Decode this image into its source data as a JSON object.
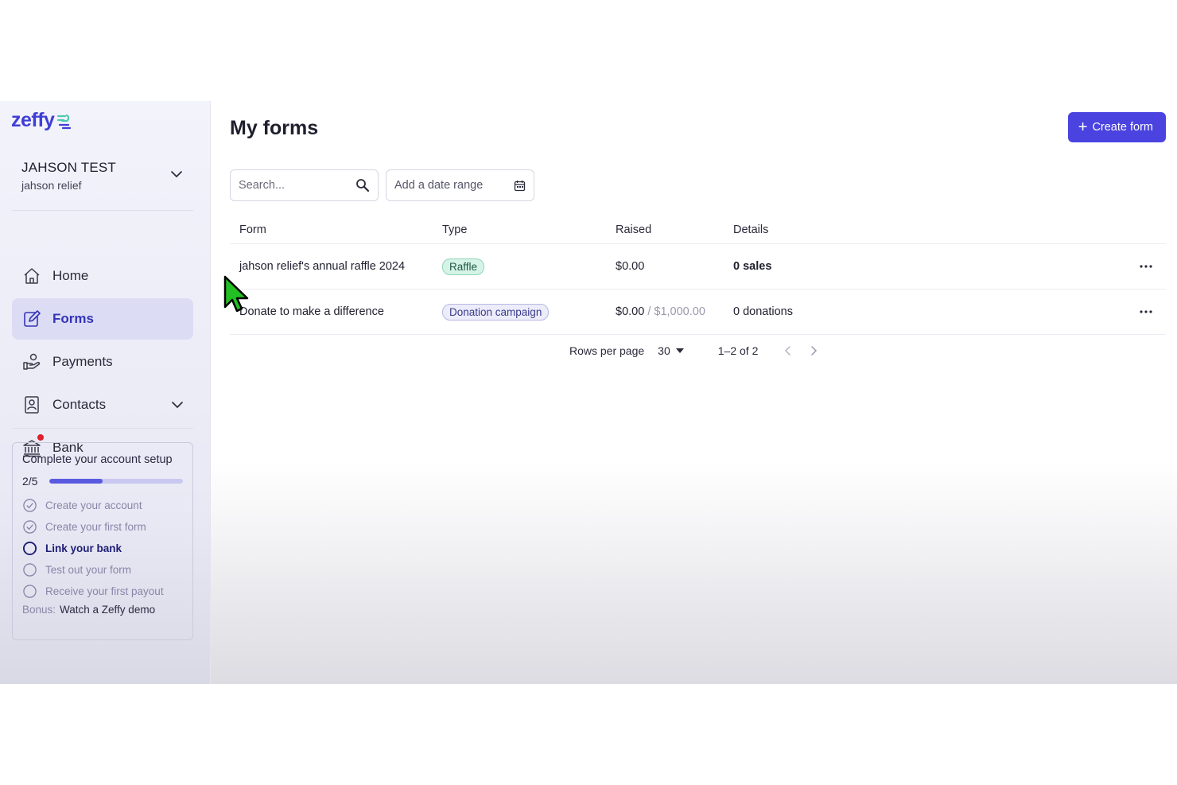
{
  "brand": {
    "logo_text": "zeffy"
  },
  "account": {
    "name": "JAHSON TEST",
    "org": "jahson relief"
  },
  "nav": {
    "items": [
      {
        "label": "Home",
        "icon": "home-icon",
        "active": false
      },
      {
        "label": "Forms",
        "icon": "form-edit-icon",
        "active": true
      },
      {
        "label": "Payments",
        "icon": "hand-coins-icon",
        "active": false
      },
      {
        "label": "Contacts",
        "icon": "contact-card-icon",
        "active": false
      },
      {
        "label": "Bank",
        "icon": "bank-icon",
        "active": false
      }
    ]
  },
  "setup": {
    "title": "Complete your account setup",
    "progress_label": "2/5",
    "progress_fraction": 0.4,
    "steps": [
      {
        "label": "Create your account",
        "state": "done"
      },
      {
        "label": "Create your first form",
        "state": "done"
      },
      {
        "label": "Link your bank",
        "state": "current"
      },
      {
        "label": "Test out your form",
        "state": "todo"
      },
      {
        "label": "Receive your first payout",
        "state": "todo"
      }
    ],
    "bonus_label": "Bonus:",
    "bonus_link": "Watch a Zeffy demo"
  },
  "main": {
    "title": "My forms",
    "create_button": "Create form",
    "search_placeholder": "Search...",
    "date_range_label": "Add a date range"
  },
  "table": {
    "headers": {
      "form": "Form",
      "type": "Type",
      "raised": "Raised",
      "details": "Details"
    },
    "rows": [
      {
        "form": "jahson relief's annual raffle 2024",
        "type": "Raffle",
        "raised": "$0.00",
        "goal": "",
        "details": "0 sales"
      },
      {
        "form": "Donate to make a difference",
        "type": "Donation campaign",
        "raised": "$0.00",
        "goal": "/ $1,000.00",
        "details": "0 donations"
      }
    ]
  },
  "pagination": {
    "rows_per_page_label": "Rows per page",
    "rows_per_page_value": "30",
    "range_label": "1–2 of 2"
  },
  "colors": {
    "accent": "#4a43e0",
    "brand": "#3f3fd6",
    "active_nav_bg": "#dcdcf5",
    "raffle_badge": "#d6f3e8",
    "campaign_badge": "#ececfa",
    "notification_dot": "#e0202a"
  }
}
